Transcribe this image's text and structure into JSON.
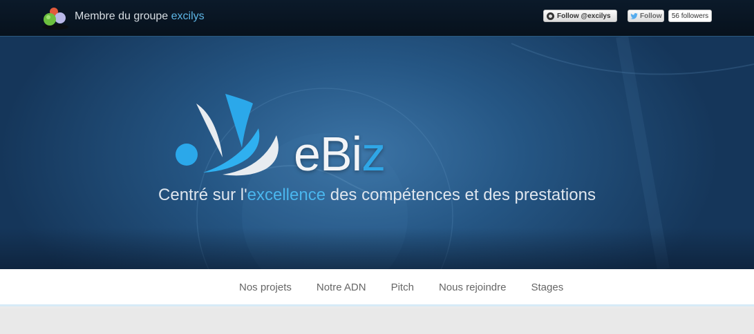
{
  "topbar": {
    "group_label": "Membre du groupe",
    "group_name": "excilys",
    "github_follow": "Follow @excilys",
    "twitter_follow": "Follow",
    "twitter_followers": "56 followers"
  },
  "hero": {
    "brand_main": "eBi",
    "brand_accent": "z",
    "tagline_prefix": "Centré sur l'",
    "tagline_accent": "excellence",
    "tagline_suffix": " des compétences et des prestations"
  },
  "nav": {
    "items": [
      "Nos projets",
      "Notre ADN",
      "Pitch",
      "Nous rejoindre",
      "Stages"
    ]
  },
  "colors": {
    "accent": "#2fa6e6",
    "topbar_bg": "#07111c",
    "hero_bg": "#255684",
    "nav_text": "#666666"
  },
  "icons": [
    "excilys-logo-icon",
    "github-icon",
    "twitter-bird-icon",
    "ebiz-logo-mark"
  ]
}
